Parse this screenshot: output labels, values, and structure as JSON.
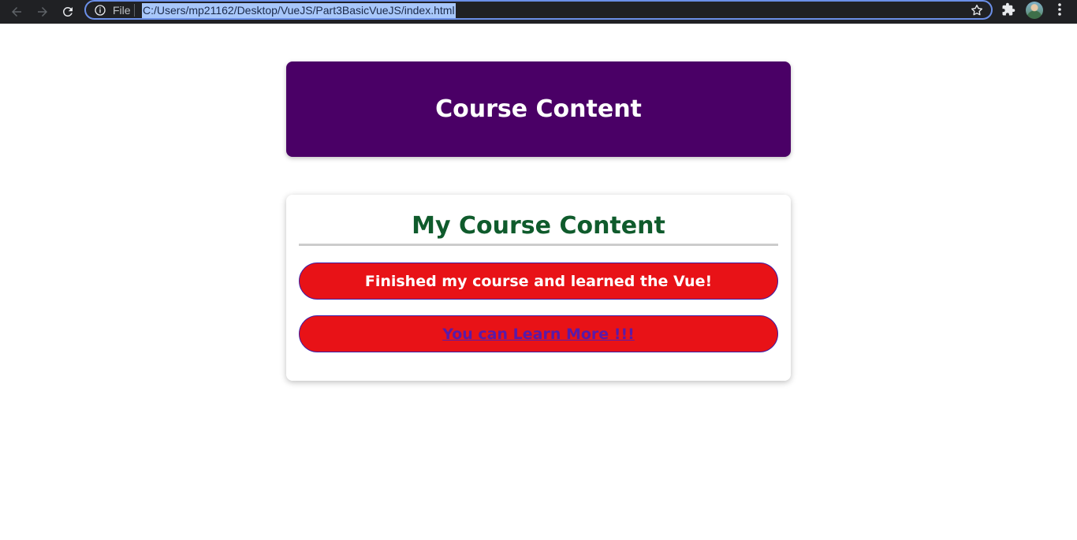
{
  "browser": {
    "scheme_label": "File",
    "url": "C:/Users/mp21162/Desktop/VueJS/Part3BasicVueJS/index.html",
    "icons": [
      "back-arrow-icon",
      "forward-arrow-icon",
      "reload-icon",
      "info-icon",
      "star-icon",
      "extensions-icon",
      "profile-avatar",
      "menu-icon"
    ]
  },
  "header": {
    "title": "Course Content",
    "background_color": "#4a0066"
  },
  "content": {
    "title": "My Course Content",
    "title_color": "#0f5b2c",
    "status_message": "Finished my course and learned the Vue!",
    "link_text": "You can Learn More !!!",
    "pill_color": "#e81217"
  }
}
